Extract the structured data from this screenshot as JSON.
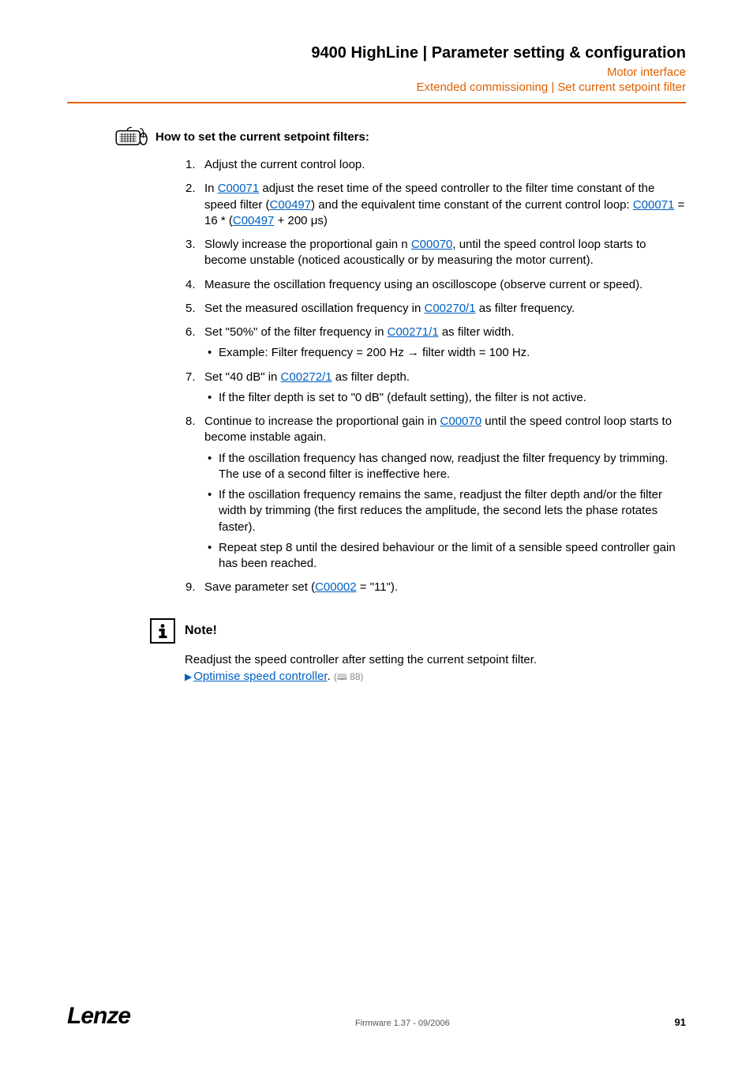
{
  "header": {
    "title": "9400 HighLine | Parameter setting & configuration",
    "subtitle1": "Motor interface",
    "subtitle2": "Extended commissioning | Set current setpoint filter"
  },
  "procedure": {
    "heading": "How to set the current setpoint filters:",
    "steps": [
      {
        "pre": "Adjust the current control loop.",
        "subs": []
      },
      {
        "pre": "In ",
        "l1": "C00071",
        "mid1": " adjust the reset time of the speed controller to the filter time constant of the speed filter (",
        "l2": "C00497",
        "mid2": ") and the equivalent time constant of the current control loop:  ",
        "l3": "C00071",
        "mid3": " = 16 * (",
        "l4": "C00497",
        "post": " + 200 μs)",
        "subs": []
      },
      {
        "pre": "Slowly increase the proportional gain n ",
        "l1": "C00070",
        "post": ", until the speed control loop starts to become unstable (noticed acoustically or by measuring the motor current).",
        "subs": []
      },
      {
        "pre": "Measure the oscillation frequency using an oscilloscope (observe current or speed).",
        "subs": []
      },
      {
        "pre": "Set the measured oscillation frequency in ",
        "l1": "C00270/1",
        "post": " as filter frequency.",
        "subs": []
      },
      {
        "pre": "Set \"50%\" of the filter frequency in ",
        "l1": "C00271/1",
        "post": " as filter width.",
        "subs": [
          {
            "text": "Example: Filter frequency = 200 Hz → filter width = 100 Hz."
          }
        ]
      },
      {
        "pre": "Set \"40 dB\" in ",
        "l1": "C00272/1",
        "post": " as filter depth.",
        "subs": [
          {
            "text": "If the filter depth is set to \"0 dB\" (default setting), the filter is not active."
          }
        ]
      },
      {
        "pre": "Continue to increase the proportional gain in ",
        "l1": "C00070",
        "post": " until the speed control loop starts to become instable again.",
        "subs": [
          {
            "text": "If the oscillation frequency has changed now, readjust the filter frequency by trimming. The use of a second filter is ineffective here."
          },
          {
            "text": "If the oscillation frequency remains the same, readjust the filter depth and/or the filter width by trimming (the first reduces the amplitude, the second lets the phase rotates faster)."
          },
          {
            "text": "Repeat step 8 until the desired behaviour or the limit of a sensible speed controller gain has been reached."
          }
        ]
      },
      {
        "pre": "Save parameter set (",
        "l1": "C00002",
        "post": " = \"11\").",
        "subs": []
      }
    ]
  },
  "note": {
    "label": "Note!",
    "body": "Readjust the speed controller after setting the current setpoint filter.",
    "link_text": "Optimise speed controller",
    "link_suffix": ".",
    "page_ref": "88"
  },
  "footer": {
    "brand": "Lenze",
    "firmware": "Firmware 1.37 - 09/2006",
    "page": "91"
  }
}
